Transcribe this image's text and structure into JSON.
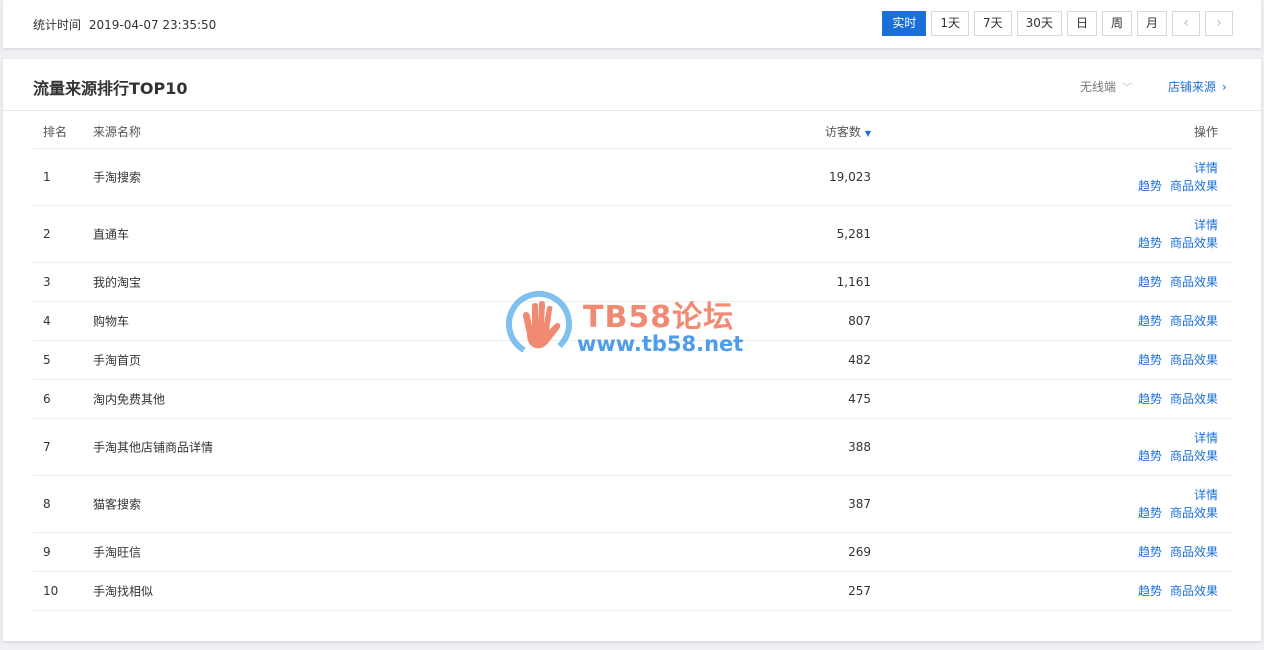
{
  "header": {
    "stat_label": "统计时间",
    "stat_time": "2019-04-07 23:35:50",
    "ranges": [
      "实时",
      "1天",
      "7天",
      "30天",
      "日",
      "周",
      "月"
    ],
    "active_range": "实时",
    "prev_icon": "chevron-left-icon",
    "next_icon": "chevron-right-icon"
  },
  "panel": {
    "title": "流量来源排行TOP10",
    "device": "无线端",
    "shop_source": "店铺来源",
    "columns": {
      "rank": "排名",
      "name": "来源名称",
      "visits": "访客数",
      "ops": "操作"
    },
    "actions": {
      "detail": "详情",
      "trend": "趋势",
      "goods": "商品效果"
    },
    "rows": [
      {
        "rank": "1",
        "name": "手淘搜索",
        "visits": "19,023",
        "has_detail": true
      },
      {
        "rank": "2",
        "name": "直通车",
        "visits": "5,281",
        "has_detail": true
      },
      {
        "rank": "3",
        "name": "我的淘宝",
        "visits": "1,161",
        "has_detail": false
      },
      {
        "rank": "4",
        "name": "购物车",
        "visits": "807",
        "has_detail": false
      },
      {
        "rank": "5",
        "name": "手淘首页",
        "visits": "482",
        "has_detail": false
      },
      {
        "rank": "6",
        "name": "淘内免费其他",
        "visits": "475",
        "has_detail": false
      },
      {
        "rank": "7",
        "name": "手淘其他店铺商品详情",
        "visits": "388",
        "has_detail": true
      },
      {
        "rank": "8",
        "name": "猫客搜索",
        "visits": "387",
        "has_detail": true
      },
      {
        "rank": "9",
        "name": "手淘旺信",
        "visits": "269",
        "has_detail": false
      },
      {
        "rank": "10",
        "name": "手淘找相似",
        "visits": "257",
        "has_detail": false
      }
    ]
  },
  "watermark": {
    "title": "TB58论坛",
    "url": "www.tb58.net"
  },
  "colors": {
    "accent": "#1a6fd8",
    "watermark_title": "#f08a72",
    "watermark_url": "#4f9ce8"
  }
}
